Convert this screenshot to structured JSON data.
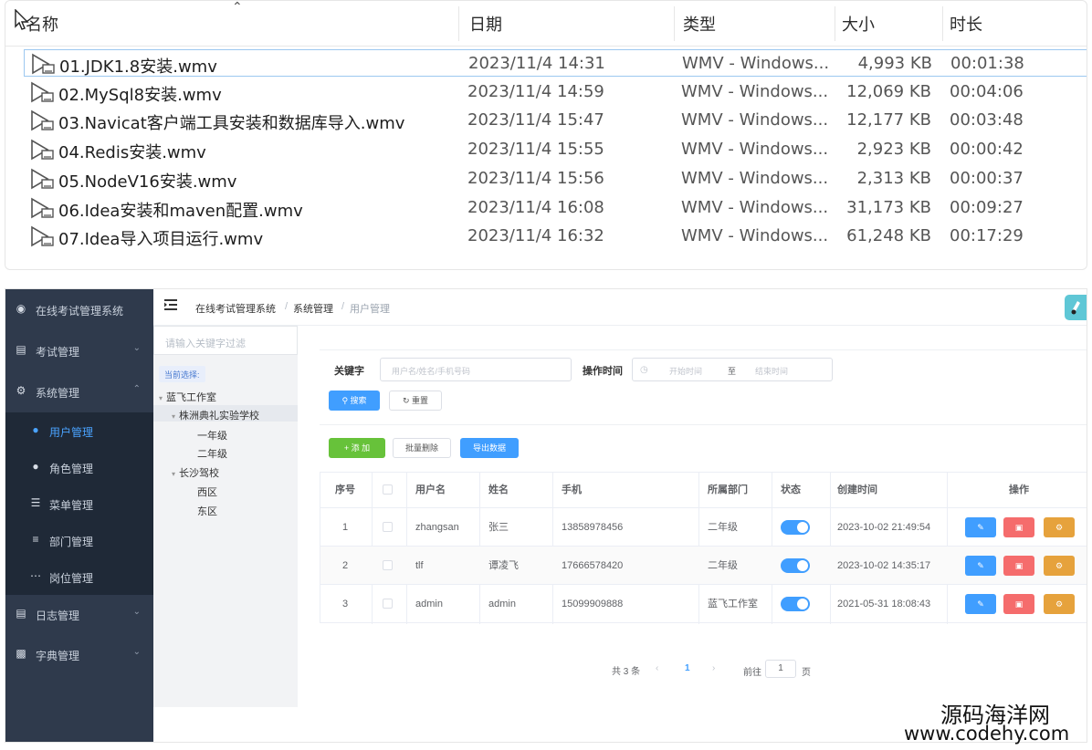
{
  "explorer": {
    "columns": {
      "name": "名称",
      "date": "日期",
      "type": "类型",
      "size": "大小",
      "duration": "时长"
    },
    "files": [
      {
        "name": "01.JDK1.8安装.wmv",
        "date": "2023/11/4 14:31",
        "type": "WMV - Windows...",
        "size": "4,993 KB",
        "duration": "00:01:38"
      },
      {
        "name": "02.MySql8安装.wmv",
        "date": "2023/11/4 14:59",
        "type": "WMV - Windows...",
        "size": "12,069 KB",
        "duration": "00:04:06"
      },
      {
        "name": "03.Navicat客户端工具安装和数据库导入.wmv",
        "date": "2023/11/4 15:47",
        "type": "WMV - Windows...",
        "size": "12,177 KB",
        "duration": "00:03:48"
      },
      {
        "name": "04.Redis安装.wmv",
        "date": "2023/11/4 15:55",
        "type": "WMV - Windows...",
        "size": "2,923 KB",
        "duration": "00:00:42"
      },
      {
        "name": "05.NodeV16安装.wmv",
        "date": "2023/11/4 15:56",
        "type": "WMV - Windows...",
        "size": "2,313 KB",
        "duration": "00:00:37"
      },
      {
        "name": "06.Idea安装和maven配置.wmv",
        "date": "2023/11/4 16:08",
        "type": "WMV - Windows...",
        "size": "31,173 KB",
        "duration": "00:09:27"
      },
      {
        "name": "07.Idea导入项目运行.wmv",
        "date": "2023/11/4 16:32",
        "type": "WMV - Windows...",
        "size": "61,248 KB",
        "duration": "00:17:29"
      }
    ]
  },
  "sidebar": {
    "app_title": "在线考试管理系统",
    "groups": {
      "exam": "考试管理",
      "system": "系统管理",
      "log": "日志管理",
      "dict": "字典管理"
    },
    "system_items": [
      "用户管理",
      "角色管理",
      "菜单管理",
      "部门管理",
      "岗位管理"
    ]
  },
  "topbar": {
    "crumbs": [
      "在线考试管理系统",
      "系统管理",
      "用户管理"
    ],
    "separator": "/"
  },
  "tree": {
    "search_placeholder": "请输入关键字过滤",
    "current_label": "当前选择:",
    "nodes": {
      "root": "蓝飞工作室",
      "school": "株洲典礼实验学校",
      "grade1": "一年级",
      "grade2": "二年级",
      "driving": "长沙驾校",
      "west": "西区",
      "east": "东区"
    }
  },
  "filters": {
    "keyword_label": "关键字",
    "keyword_placeholder": "用户名/姓名/手机号码",
    "time_label": "操作时间",
    "start_placeholder": "开始时间",
    "to": "至",
    "end_placeholder": "结束时间",
    "search_btn": "搜索",
    "reset_btn": "重置"
  },
  "toolbar": {
    "add_btn": "添 加",
    "batch_delete_btn": "批量删除",
    "export_btn": "导出数据"
  },
  "table": {
    "headers": {
      "index": "序号",
      "username": "用户名",
      "name": "姓名",
      "phone": "手机",
      "dept": "所属部门",
      "status": "状态",
      "created": "创建时间",
      "actions": "操作"
    },
    "rows": [
      {
        "index": "1",
        "username": "zhangsan",
        "name": "张三",
        "phone": "13858978456",
        "dept": "二年级",
        "status": true,
        "created": "2023-10-02 21:49:54"
      },
      {
        "index": "2",
        "username": "tlf",
        "name": "谭凌飞",
        "phone": "17666578420",
        "dept": "二年级",
        "status": true,
        "created": "2023-10-02 14:35:17"
      },
      {
        "index": "3",
        "username": "admin",
        "name": "admin",
        "phone": "15099909888",
        "dept": "蓝飞工作室",
        "status": true,
        "created": "2021-05-31 18:08:43"
      }
    ]
  },
  "pagination": {
    "total": "共 3 条",
    "current_page": "1",
    "goto": "前往",
    "goto_value": "1",
    "page_unit": "页"
  },
  "watermark": {
    "line1": "源码海洋网",
    "line2": "www.codehy.com"
  },
  "colors": {
    "sidebar_bg": "#2f3a4c",
    "primary": "#409eff",
    "success": "#67c23a",
    "danger": "#f56c6c",
    "warning": "#e6a23c"
  }
}
